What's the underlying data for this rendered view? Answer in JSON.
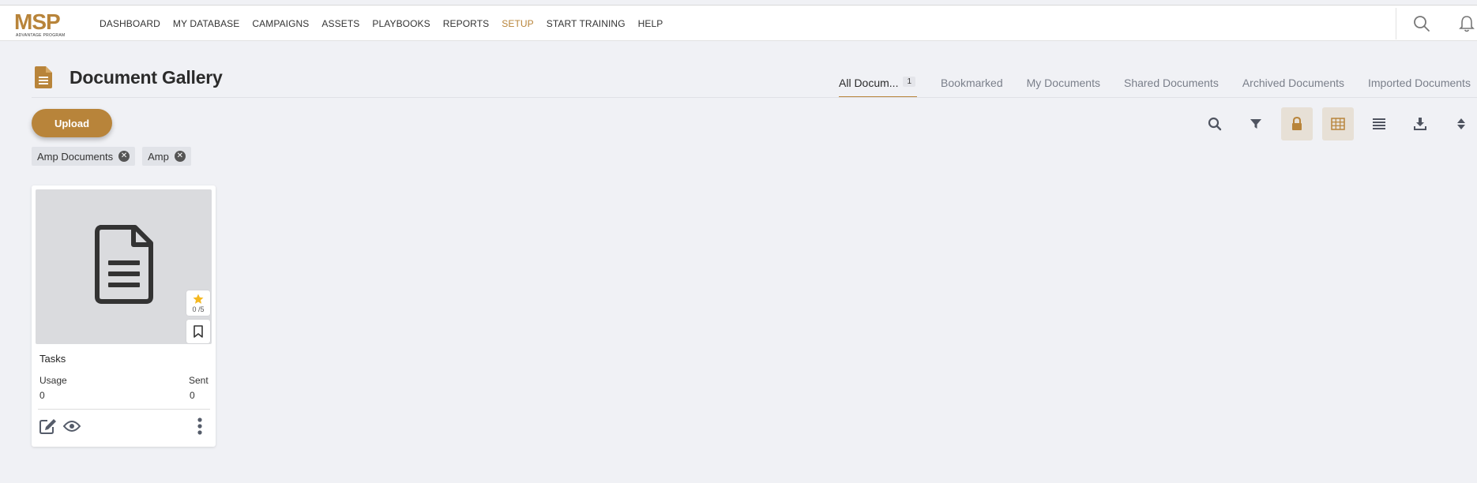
{
  "nav": {
    "items": [
      {
        "label": "DASHBOARD",
        "active": false
      },
      {
        "label": "MY DATABASE",
        "active": false
      },
      {
        "label": "CAMPAIGNS",
        "active": false
      },
      {
        "label": "ASSETS",
        "active": false
      },
      {
        "label": "PLAYBOOKS",
        "active": false
      },
      {
        "label": "REPORTS",
        "active": false
      },
      {
        "label": "SETUP",
        "active": true
      },
      {
        "label": "START TRAINING",
        "active": false
      },
      {
        "label": "HELP",
        "active": false
      }
    ],
    "logo_text": "MSP",
    "logo_subtext": "ADVANTAGE PROGRAM",
    "icons": [
      "search-icon",
      "bell-icon"
    ]
  },
  "page": {
    "title": "Document Gallery",
    "title_icon": "document-icon"
  },
  "tabs": [
    {
      "label": "All Docum...",
      "count": "1",
      "active": true
    },
    {
      "label": "Bookmarked",
      "active": false
    },
    {
      "label": "My Documents",
      "active": false
    },
    {
      "label": "Shared Documents",
      "active": false
    },
    {
      "label": "Archived Documents",
      "active": false
    },
    {
      "label": "Imported Documents",
      "active": false
    }
  ],
  "toolbar": {
    "upload_label": "Upload",
    "tools": [
      "search-icon",
      "filter-icon",
      "lock-icon",
      "grid-view-icon",
      "list-view-icon",
      "download-icon",
      "sort-icon"
    ]
  },
  "filters": [
    {
      "label": "Amp Documents"
    },
    {
      "label": "Amp"
    }
  ],
  "cards": [
    {
      "title": "Tasks",
      "rating": "0 /5",
      "usage_label": "Usage",
      "usage_value": "0",
      "sent_label": "Sent",
      "sent_value": "0"
    }
  ],
  "colors": {
    "accent": "#b8843a",
    "background": "#f0f1f5",
    "star": "#f5b820"
  }
}
